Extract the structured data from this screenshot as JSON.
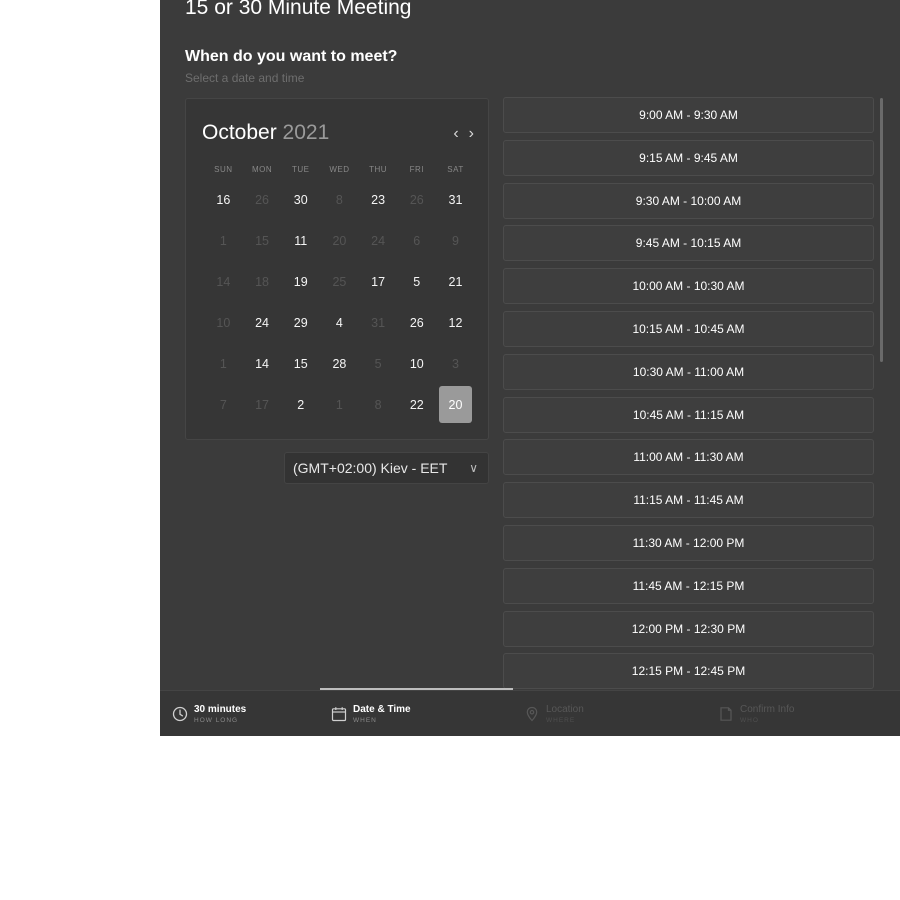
{
  "header": {
    "title": "15 or 30 Minute Meeting",
    "question": "When do you want to meet?",
    "subtitle": "Select a date and time"
  },
  "calendar": {
    "month": "October",
    "year": "2021",
    "prev_icon": "chevron-left-icon",
    "next_icon": "chevron-right-icon",
    "weekdays": [
      "SUN",
      "MON",
      "TUE",
      "WED",
      "THU",
      "FRI",
      "SAT"
    ],
    "days": [
      {
        "label": "16",
        "available": true
      },
      {
        "label": "26",
        "available": false
      },
      {
        "label": "30",
        "available": true
      },
      {
        "label": "8",
        "available": false
      },
      {
        "label": "23",
        "available": true
      },
      {
        "label": "26",
        "available": false
      },
      {
        "label": "31",
        "available": true
      },
      {
        "label": "1",
        "available": false
      },
      {
        "label": "15",
        "available": false
      },
      {
        "label": "11",
        "available": true
      },
      {
        "label": "20",
        "available": false
      },
      {
        "label": "24",
        "available": false
      },
      {
        "label": "6",
        "available": false
      },
      {
        "label": "9",
        "available": false
      },
      {
        "label": "14",
        "available": false
      },
      {
        "label": "18",
        "available": false
      },
      {
        "label": "19",
        "available": true
      },
      {
        "label": "25",
        "available": false
      },
      {
        "label": "17",
        "available": true
      },
      {
        "label": "5",
        "available": true
      },
      {
        "label": "21",
        "available": true
      },
      {
        "label": "10",
        "available": false
      },
      {
        "label": "24",
        "available": true
      },
      {
        "label": "29",
        "available": true
      },
      {
        "label": "4",
        "available": true
      },
      {
        "label": "31",
        "available": false
      },
      {
        "label": "26",
        "available": true
      },
      {
        "label": "12",
        "available": true
      },
      {
        "label": "1",
        "available": false
      },
      {
        "label": "14",
        "available": true
      },
      {
        "label": "15",
        "available": true
      },
      {
        "label": "28",
        "available": true
      },
      {
        "label": "5",
        "available": false
      },
      {
        "label": "10",
        "available": true
      },
      {
        "label": "3",
        "available": false
      },
      {
        "label": "7",
        "available": false
      },
      {
        "label": "17",
        "available": false
      },
      {
        "label": "2",
        "available": true
      },
      {
        "label": "1",
        "available": false
      },
      {
        "label": "8",
        "available": false
      },
      {
        "label": "22",
        "available": true
      },
      {
        "label": "20",
        "available": true,
        "selected": true
      }
    ]
  },
  "timezone": {
    "value": "(GMT+02:00) Kiev - EET",
    "icon": "chevron-down-icon"
  },
  "time_slots": [
    "9:00 AM - 9:30 AM",
    "9:15 AM - 9:45 AM",
    "9:30 AM - 10:00 AM",
    "9:45 AM - 10:15 AM",
    "10:00 AM - 10:30 AM",
    "10:15 AM - 10:45 AM",
    "10:30 AM - 11:00 AM",
    "10:45 AM - 11:15 AM",
    "11:00 AM - 11:30 AM",
    "11:15 AM - 11:45 AM",
    "11:30 AM - 12:00 PM",
    "11:45 AM - 12:15 PM",
    "12:00 PM - 12:30 PM",
    "12:15 PM - 12:45 PM"
  ],
  "steps": {
    "duration": {
      "label": "30 minutes",
      "sub": "HOW LONG",
      "icon": "clock-icon"
    },
    "datetime": {
      "label": "Date & Time",
      "sub": "WHEN",
      "icon": "calendar-icon"
    },
    "location": {
      "label": "Location",
      "sub": "WHERE",
      "icon": "map-pin-icon"
    },
    "confirm": {
      "label": "Confirm Info",
      "sub": "WHO",
      "icon": "document-icon"
    }
  },
  "colors": {
    "panel_bg": "#3b3b3b",
    "selected_day": "#9a9a9a",
    "text": "#ffffff"
  }
}
